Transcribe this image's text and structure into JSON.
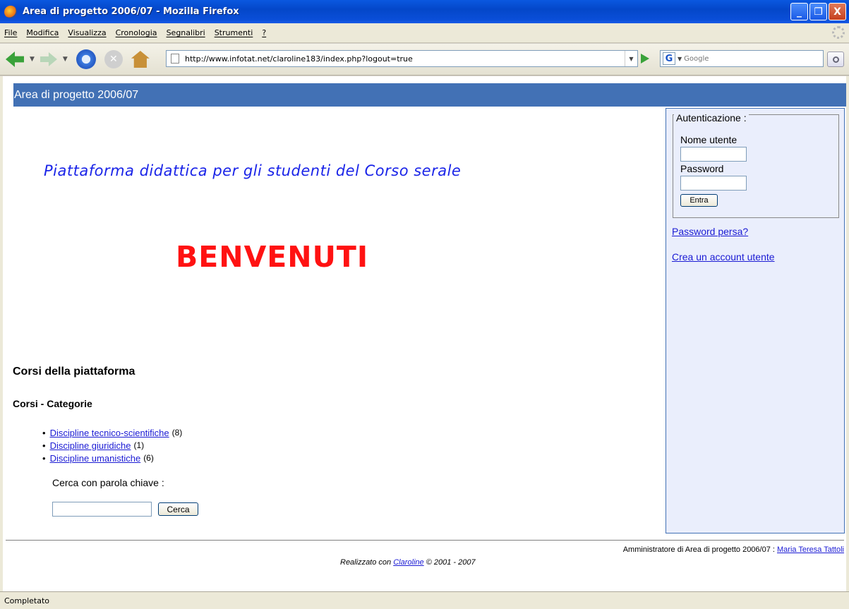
{
  "window": {
    "title": "Area di progetto 2006/07 - Mozilla Firefox",
    "min_glyph": "_",
    "max_glyph": "❐",
    "close_glyph": "X"
  },
  "menu": [
    "File",
    "Modifica",
    "Visualizza",
    "Cronologia",
    "Segnalibri",
    "Strumenti",
    "?"
  ],
  "toolbar": {
    "url": "http://www.infotat.net/claroline183/index.php?logout=true",
    "search_placeholder": "Google",
    "stop_glyph": "✕",
    "search_engine_glyph": "G"
  },
  "page": {
    "banner": "Area di progetto 2006/07",
    "tagline": "Piattaforma didattica per gli studenti del Corso serale",
    "welcome": "BENVENUTI",
    "courses_title": "Corsi della piattaforma",
    "categories_title": "Corsi - Categorie",
    "categories": [
      {
        "label": "Discipline tecnico-scientifiche",
        "count": "(8)"
      },
      {
        "label": "Discipline giuridiche",
        "count": "(1)"
      },
      {
        "label": "Discipline umanistiche",
        "count": "(6)"
      }
    ],
    "keyword_label": "Cerca con parola chiave :",
    "search_button": "Cerca"
  },
  "sidebar": {
    "legend": "Autenticazione :",
    "username_label": "Nome utente",
    "password_label": "Password",
    "login_button": "Entra",
    "lost_password": "Password persa?",
    "create_account": "Crea un account utente"
  },
  "footer": {
    "admin_prefix": "Amministratore di Area di progetto 2006/07 :",
    "admin_name": "Maria Teresa Tattoli",
    "credits_prefix": "Realizzato con",
    "credits_link": "Claroline",
    "credits_suffix": "© 2001 - 2007"
  },
  "status": "Completato",
  "colors": {
    "banner": "#4271b5",
    "tagline": "#1a24e8",
    "welcome": "#ff1212",
    "link": "#1b1bd4",
    "sidebar_bg": "#eaeefc"
  }
}
